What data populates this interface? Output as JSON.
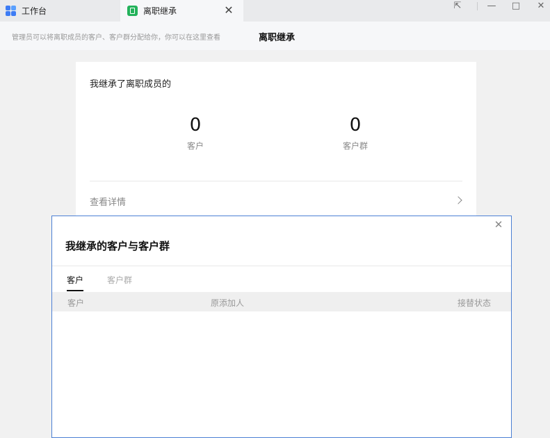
{
  "tabbar": {
    "tabs": [
      {
        "label": "工作台"
      },
      {
        "label": "离职继承"
      }
    ],
    "close_symbol": "✕",
    "window_controls": {
      "restore_symbol": "⇱",
      "minimize_symbol": "—",
      "maximize_symbol": "□",
      "close_symbol": "✕"
    }
  },
  "subheader": {
    "hint": "管理员可以将离职成员的客户、客户群分配给你，你可以在这里查看",
    "title": "离职继承"
  },
  "card": {
    "title": "我继承了离职成员的",
    "stats": [
      {
        "value": "0",
        "label": "客户"
      },
      {
        "value": "0",
        "label": "客户群"
      }
    ],
    "detail_link": "查看详情"
  },
  "modal": {
    "title": "我继承的客户与客户群",
    "close_symbol": "✕",
    "tabs": [
      {
        "label": "客户",
        "active": true
      },
      {
        "label": "客户群",
        "active": false
      }
    ],
    "table": {
      "columns": [
        "客户",
        "原添加人",
        "接替状态"
      ],
      "rows": []
    }
  },
  "colors": {
    "accent_blue": "#3d7cf5",
    "doc_icon_green": "#23b25b",
    "modal_border": "#4b7fd4"
  }
}
